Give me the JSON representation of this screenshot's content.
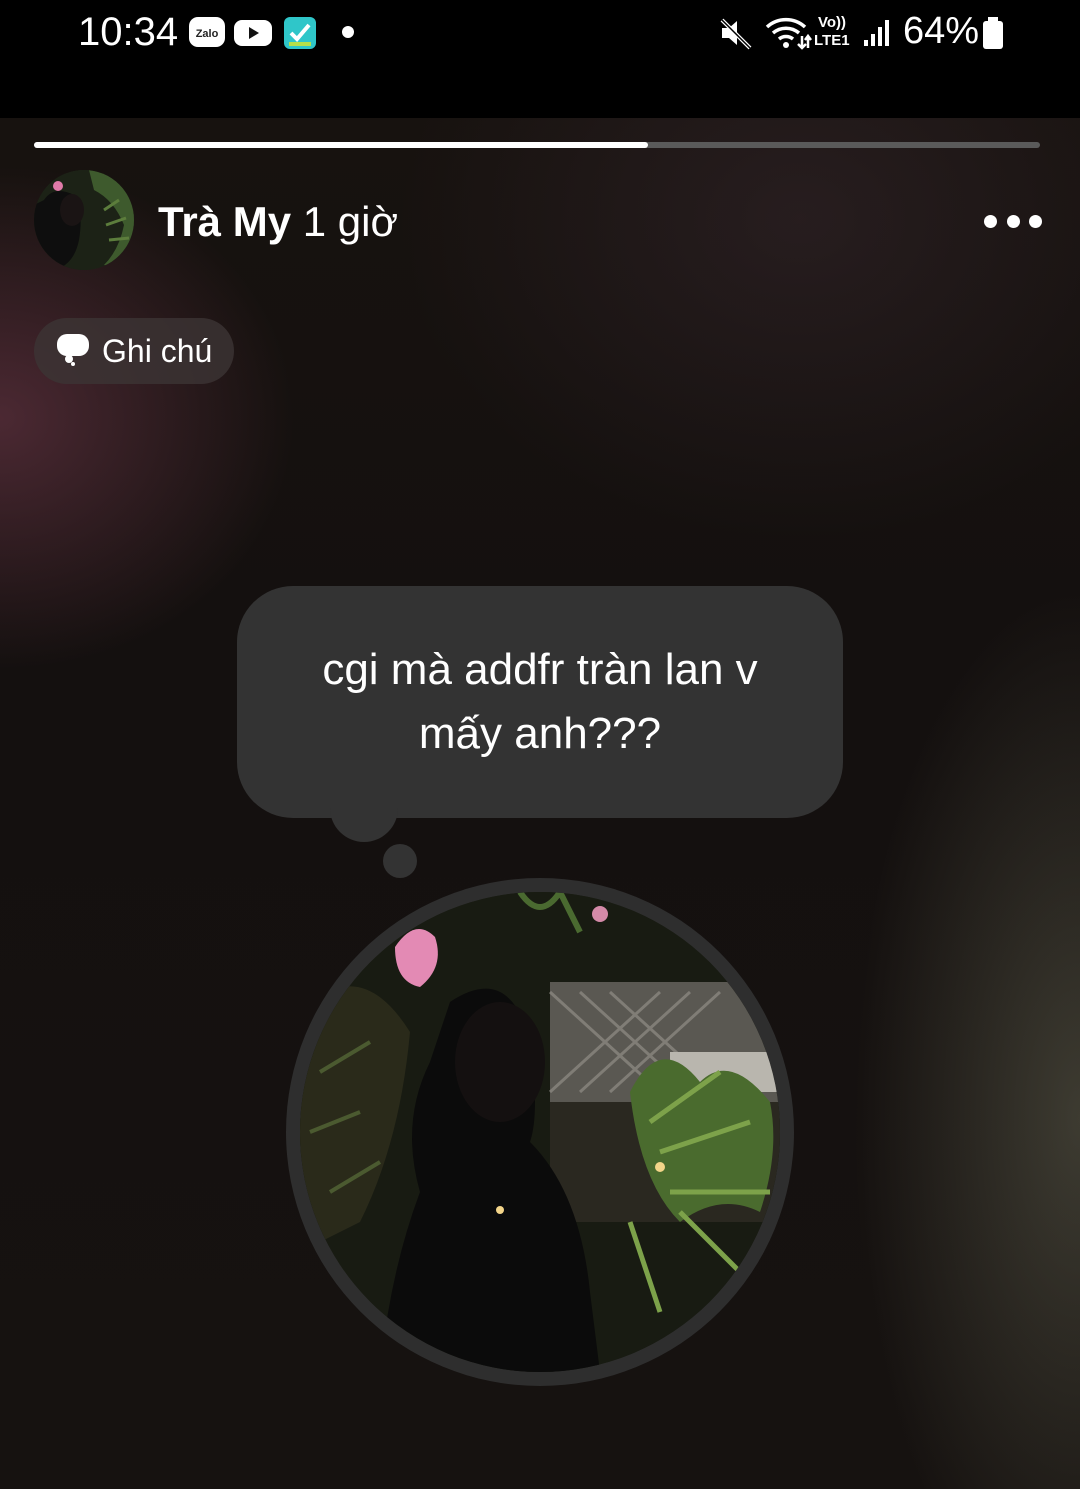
{
  "status_bar": {
    "time": "10:34",
    "notification_icons": [
      "zalo-icon",
      "youtube-icon",
      "check-app-icon",
      "dot-icon"
    ],
    "zalo_label": "Zalo",
    "right_icons": [
      "mute-icon",
      "wifi-icon",
      "volte-icon",
      "signal-icon",
      "battery-icon"
    ],
    "volte_label_top": "Vo))",
    "volte_label_bottom": "LTE1",
    "battery": "64%"
  },
  "story": {
    "progress": 0.61,
    "author_name": "Trà My",
    "time_ago": "1 giờ",
    "more_icon": "more-horizontal-icon",
    "chip": {
      "icon": "thought-bubble-icon",
      "label": "Ghi chú"
    },
    "note_text": "cgi mà addfr tràn lan v mấy anh???",
    "colors": {
      "bubble": "#333333",
      "progress_fill": "#ffffff",
      "progress_track": "#5a5a5a"
    }
  }
}
